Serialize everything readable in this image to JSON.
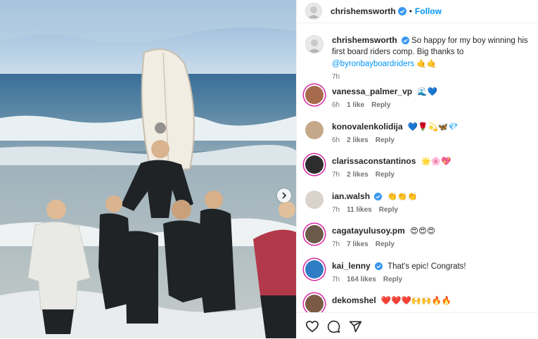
{
  "header": {
    "username": "chrishemsworth",
    "dot": "•",
    "follow_label": "Follow"
  },
  "caption": {
    "username": "chrishemsworth",
    "text": "So happy for my boy winning his first board riders comp. Big thanks to",
    "mention": "@byronbayboardriders",
    "emoji": "🤙🤙",
    "time": "7h"
  },
  "comments": [
    {
      "username": "vanessa_palmer_vp",
      "text": "🌊💙",
      "time": "6h",
      "likes": "1 like",
      "reply": "Reply"
    },
    {
      "username": "konovalenkolidija",
      "text": "💙🌹💫🦋💎",
      "time": "6h",
      "likes": "2 likes",
      "reply": "Reply"
    },
    {
      "username": "clarissaconstantinos",
      "text": "🌟🌸💖",
      "time": "7h",
      "likes": "2 likes",
      "reply": "Reply"
    },
    {
      "username": "ian.walsh",
      "text": "👏👏👏",
      "time": "7h",
      "likes": "11 likes",
      "reply": "Reply"
    },
    {
      "username": "cagatayulusoy.pm",
      "text": "😍😍😍",
      "time": "7h",
      "likes": "7 likes",
      "reply": "Reply"
    },
    {
      "username": "kai_lenny",
      "text": "That's epic! Congrats!",
      "time": "7h",
      "likes": "164 likes",
      "reply": "Reply"
    },
    {
      "username": "dekomshel",
      "text": "❤️❤️❤️🙌🙌🔥🔥",
      "time": "",
      "likes": "",
      "reply": ""
    }
  ],
  "colors": {
    "link": "#0095f6",
    "verified": "#3897f0",
    "story_ring": "#d6249f"
  },
  "icons": [
    "heart-icon",
    "comment-icon",
    "share-icon",
    "verified-icon",
    "chevron-right-icon"
  ]
}
